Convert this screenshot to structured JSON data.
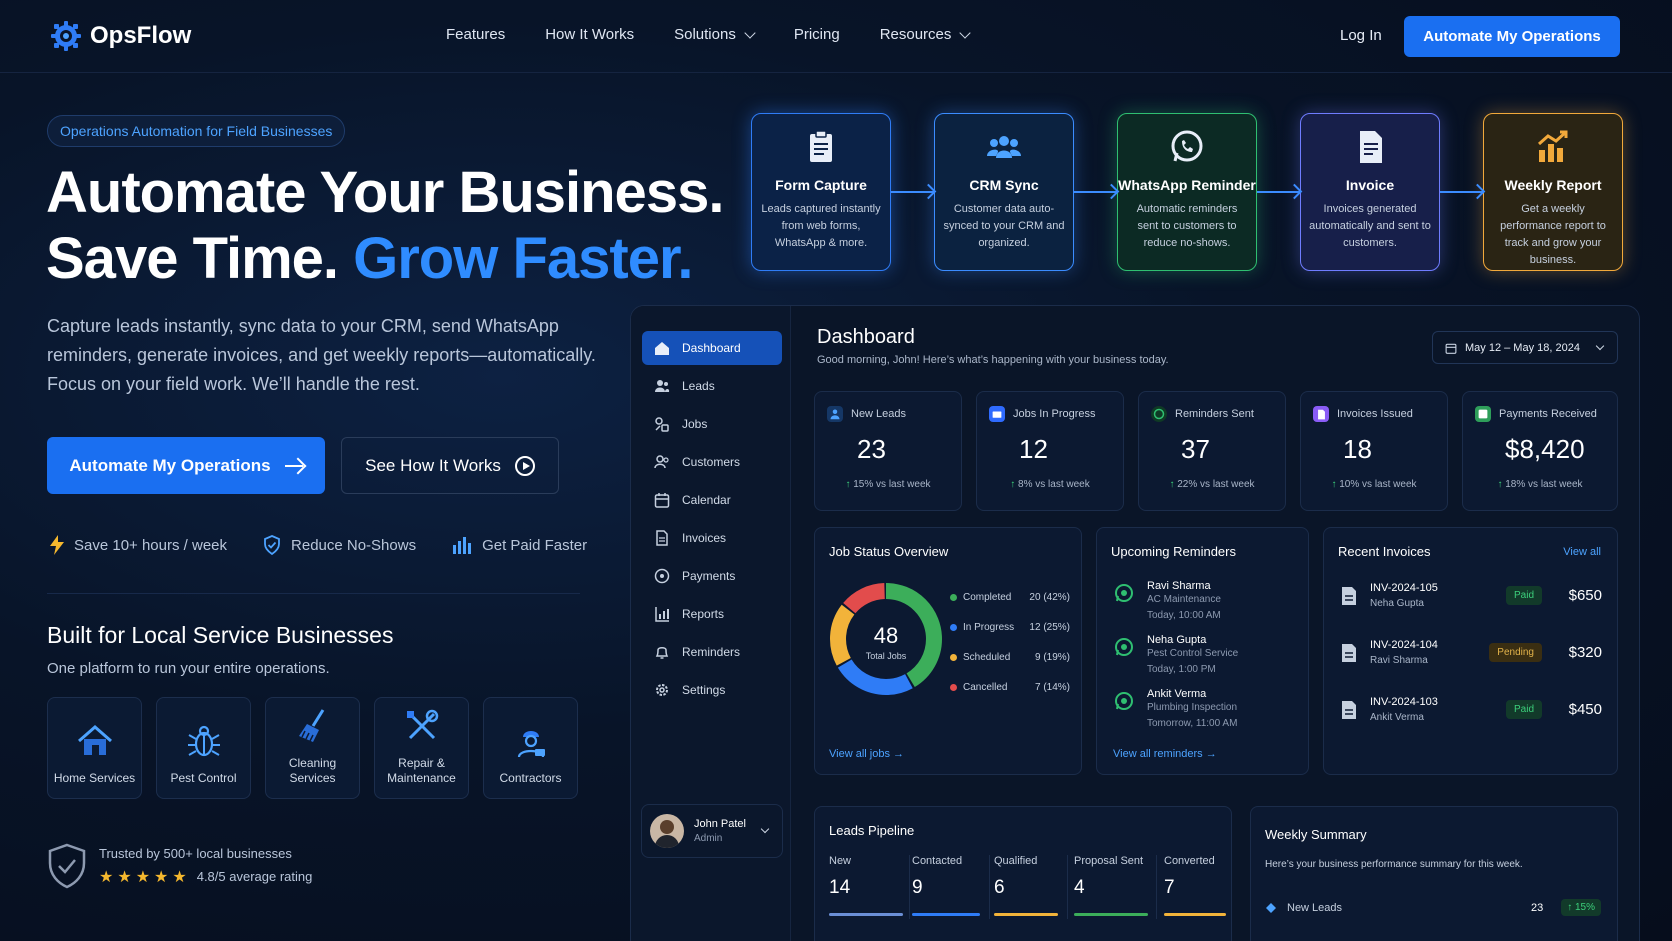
{
  "brand": {
    "name": "OpsFlow"
  },
  "nav": {
    "links": [
      "Features",
      "How It Works",
      "Solutions",
      "Pricing",
      "Resources"
    ],
    "login": "Log In",
    "cta": "Automate My Operations"
  },
  "hero": {
    "badge": "Operations Automation for Field Businesses",
    "title_line1": "Automate Your Business.",
    "title_line2a": "Save Time. ",
    "title_line2b": "Grow Faster.",
    "lead": "Capture leads instantly, sync data to your CRM, send WhatsApp reminders, generate invoices, and get weekly reports—automatically. Focus on your field work. We’ll handle the rest.",
    "primary_cta": "Automate My Operations",
    "secondary_cta": "See How It Works",
    "perks": [
      "Save 10+ hours / week",
      "Reduce No-Shows",
      "Get Paid Faster"
    ]
  },
  "built": {
    "title": "Built for Local Service Businesses",
    "subtitle": "One platform to run your entire operations.",
    "tiles": [
      "Home Services",
      "Pest Control",
      "Cleaning Services",
      "Repair & Maintenance",
      "Contractors"
    ]
  },
  "trust": {
    "text": "Trusted by 500+ local businesses",
    "rating": "4.8/5 average rating"
  },
  "flow": [
    {
      "title": "Form Capture",
      "desc": "Leads captured instantly from web forms, WhatsApp & more.",
      "color": "#2f8cff"
    },
    {
      "title": "CRM Sync",
      "desc": "Customer data auto-synced to your CRM and organized.",
      "color": "#4da3ff"
    },
    {
      "title": "WhatsApp Reminder",
      "desc": "Automatic reminders sent to customers to reduce no-shows.",
      "color": "#2fbf71"
    },
    {
      "title": "Invoice",
      "desc": "Invoices generated automatically and sent to customers.",
      "color": "#6f7cff"
    },
    {
      "title": "Weekly Report",
      "desc": "Get a weekly performance report to track and grow your business.",
      "color": "#f2a93b"
    }
  ],
  "dashboard": {
    "sidebar": [
      "Dashboard",
      "Leads",
      "Jobs",
      "Customers",
      "Calendar",
      "Invoices",
      "Payments",
      "Reports",
      "Reminders",
      "Settings"
    ],
    "user": {
      "name": "John Patel",
      "role": "Admin"
    },
    "title": "Dashboard",
    "greeting": "Good morning, John! Here’s what’s happening with your business today.",
    "date_range": "May 12 – May 18, 2024",
    "stats": [
      {
        "label": "New Leads",
        "value": "23",
        "delta": "15%",
        "note": " vs last week",
        "color": "#2f8cff"
      },
      {
        "label": "Jobs In Progress",
        "value": "12",
        "delta": "8%",
        "note": " vs last week",
        "color": "#2f6bff"
      },
      {
        "label": "Reminders Sent",
        "value": "37",
        "delta": "22%",
        "note": " vs last week",
        "color": "#2fbf71"
      },
      {
        "label": "Invoices Issued",
        "value": "18",
        "delta": "10%",
        "note": " vs last week",
        "color": "#8a5cf6"
      },
      {
        "label": "Payments Received",
        "value": "$8,420",
        "delta": "18%",
        "note": " vs last week",
        "color": "#3ccf7b"
      }
    ],
    "job_status": {
      "title": "Job Status Overview",
      "total": "48",
      "total_label": "Total Jobs",
      "items": [
        {
          "label": "Completed",
          "value": "20 (42%)",
          "pct": 42,
          "color": "#3cae5a"
        },
        {
          "label": "In Progress",
          "value": "12 (25%)",
          "pct": 25,
          "color": "#2f7cf6"
        },
        {
          "label": "Scheduled",
          "value": "9 (19%)",
          "pct": 19,
          "color": "#f2b33a"
        },
        {
          "label": "Cancelled",
          "value": "7 (14%)",
          "pct": 14,
          "color": "#e24c4c"
        }
      ],
      "link": "View all jobs →"
    },
    "reminders": {
      "title": "Upcoming Reminders",
      "items": [
        {
          "name": "Ravi Sharma",
          "service": "AC Maintenance",
          "time": "Today, 10:00 AM"
        },
        {
          "name": "Neha Gupta",
          "service": "Pest Control Service",
          "time": "Today, 1:00 PM"
        },
        {
          "name": "Ankit Verma",
          "service": "Plumbing Inspection",
          "time": "Tomorrow, 11:00 AM"
        }
      ],
      "link": "View all reminders →"
    },
    "invoices": {
      "title": "Recent Invoices",
      "link": "View all",
      "items": [
        {
          "id": "INV-2024-105",
          "customer": "Neha Gupta",
          "status": "Paid",
          "amount": "$650"
        },
        {
          "id": "INV-2024-104",
          "customer": "Ravi Sharma",
          "status": "Pending",
          "amount": "$320"
        },
        {
          "id": "INV-2024-103",
          "customer": "Ankit Verma",
          "status": "Paid",
          "amount": "$450"
        }
      ]
    },
    "pipeline": {
      "title": "Leads Pipeline",
      "stages": [
        {
          "label": "New",
          "value": "14",
          "color": "#6b8fd6"
        },
        {
          "label": "Contacted",
          "value": "9",
          "color": "#2f7cf6"
        },
        {
          "label": "Qualified",
          "value": "6",
          "color": "#f2b33a"
        },
        {
          "label": "Proposal Sent",
          "value": "4",
          "color": "#3cae5a"
        },
        {
          "label": "Converted",
          "value": "7",
          "color": "#f2b33a"
        }
      ]
    },
    "weekly": {
      "title": "Weekly Summary",
      "subtitle": "Here’s your business performance summary for this week.",
      "row_label": "New Leads",
      "row_value": "23",
      "row_delta": "↑ 15%"
    }
  }
}
